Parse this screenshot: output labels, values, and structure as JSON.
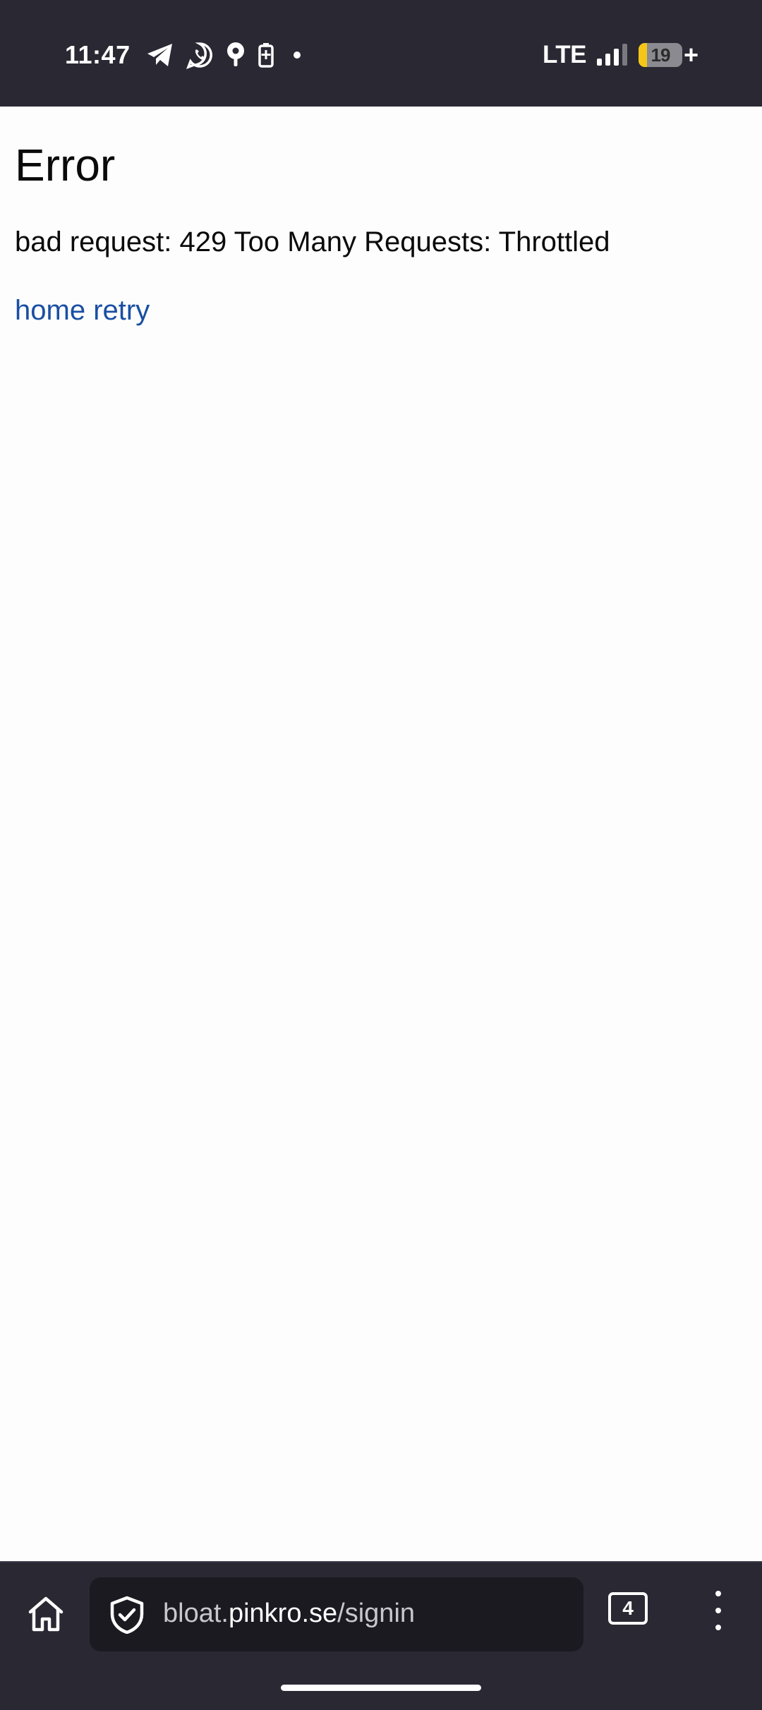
{
  "status_bar": {
    "time": "11:47",
    "notification_icons": [
      "telegram-icon",
      "whatsapp-icon",
      "location-icon",
      "battery-saver-icon",
      "dot-icon"
    ],
    "network": "LTE",
    "signal_icon": "signal-bars-icon",
    "battery_level": "19",
    "battery_fraction": 0.19,
    "battery_color": "#f5c518",
    "battery_plus": "+"
  },
  "page": {
    "heading": "Error",
    "message": "bad request: 429 Too Many Requests: Throttled",
    "links": [
      {
        "label": "home"
      },
      {
        "label": "retry"
      }
    ],
    "link_color": "#1a4fa3"
  },
  "toolbar": {
    "home_icon": "home-icon",
    "security_icon": "shield-check-icon",
    "url_domain": "bloat.",
    "url_host": "pinkro.se",
    "url_path": "/signin",
    "tab_count": "4",
    "menu_icon": "more-vertical-icon"
  }
}
